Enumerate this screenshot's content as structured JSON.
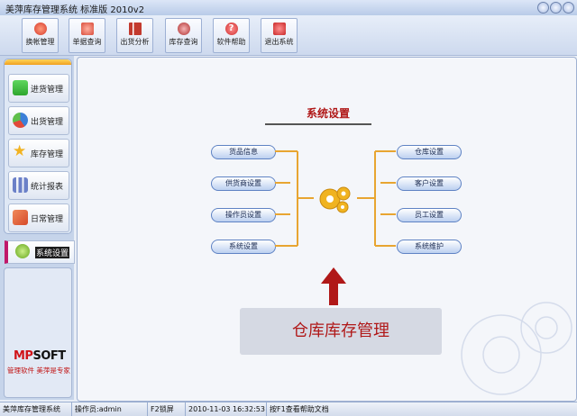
{
  "window": {
    "title": "美萍库存管理系统 标准版 2010v2"
  },
  "toolbar": {
    "buttons": [
      {
        "label": "换帐管理",
        "icon": "account-switch-icon",
        "color": "#d63a2c"
      },
      {
        "label": "单据查询",
        "icon": "document-search-icon",
        "color": "#d94c3a"
      },
      {
        "label": "出货分析",
        "icon": "bar-chart-icon",
        "color": "#c33a2e"
      },
      {
        "label": "库存查询",
        "icon": "warehouse-icon",
        "color": "#b03030"
      },
      {
        "label": "软件帮助",
        "icon": "help-icon",
        "color": "#cf2f2f"
      },
      {
        "label": "退出系统",
        "icon": "power-icon",
        "color": "#c92828"
      }
    ]
  },
  "sidebar": {
    "items": [
      {
        "label": "进货管理",
        "icon": "plus-icon",
        "color": "#2ea62e"
      },
      {
        "label": "出货管理",
        "icon": "pie-chart-icon",
        "color": "#3b7fd8"
      },
      {
        "label": "库存管理",
        "icon": "star-icon",
        "color": "#f2b321"
      },
      {
        "label": "统计报表",
        "icon": "bar-chart-icon",
        "color": "#6b80c8"
      },
      {
        "label": "日常管理",
        "icon": "tools-icon",
        "color": "#d64a2a"
      }
    ],
    "active": {
      "label": "系统设置",
      "icon": "gear-icon"
    },
    "logo": {
      "brand_red": "MP",
      "brand_black": "SOFT",
      "slogan": "管理软件 美萍是专家"
    }
  },
  "main": {
    "section_title": "系统设置",
    "left_items": [
      "货品信息",
      "供货商设置",
      "操作员设置",
      "系统设置"
    ],
    "right_items": [
      "仓库设置",
      "客户设置",
      "员工设置",
      "系统维护"
    ],
    "banner_text": "仓库库存管理",
    "accent": "#e8a531"
  },
  "statusbar": {
    "app": "美萍库存管理系统",
    "operator": "操作员:admin",
    "lock": "F2锁屏",
    "datetime": "2010-11-03 16:32:53",
    "help": "按F1查看帮助文档"
  }
}
